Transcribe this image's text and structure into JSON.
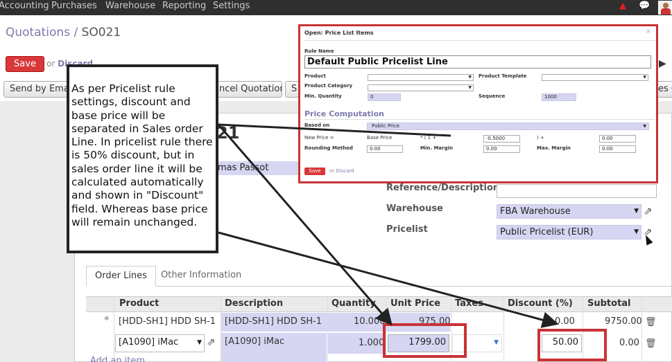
{
  "nav": {
    "menu": [
      "Accounting",
      "Purchases",
      "Warehouse",
      "Reporting",
      "Settings"
    ],
    "icons": [
      "warning-icon",
      "chat-icon",
      "avatar"
    ]
  },
  "breadcrumb": {
    "parent": "Quotations",
    "separator": " / ",
    "current": "SO021"
  },
  "toolbar": {
    "save": "Save",
    "or": "or",
    "discard": "Discard"
  },
  "actions": {
    "send_by_email": "Send by Email",
    "cancel_quotation": "Cancel Quotation",
    "btn3": "S",
    "btn4": "es C"
  },
  "form": {
    "so_number_fragment": "21",
    "customer_fragment": "mas Passot",
    "reference_label": "Reference/Description",
    "reference_value": "",
    "warehouse_label": "Warehouse",
    "warehouse_value": "FBA Warehouse",
    "pricelist_label": "Pricelist",
    "pricelist_value": "Public Pricelist (EUR)"
  },
  "tabs": [
    "Order Lines",
    "Other Information"
  ],
  "table": {
    "headers": [
      "Product",
      "Description",
      "Quantity",
      "Unit Price",
      "Taxes",
      "Discount (%)",
      "Subtotal"
    ],
    "rows": [
      {
        "product": "[HDD-SH1] HDD SH-1",
        "description": "[HDD-SH1] HDD SH-1",
        "quantity": "10.000",
        "unit_price": "975.00",
        "taxes": "",
        "discount": "0.00",
        "subtotal": "9750.00"
      },
      {
        "product": "[A1090] iMac",
        "description": "[A1090] iMac",
        "quantity": "1.000",
        "unit_price": "1799.00",
        "taxes": "",
        "discount": "50.00",
        "subtotal": "0.00"
      }
    ],
    "add_item": "Add an item"
  },
  "popup": {
    "title": "Open: Price List Items",
    "close": "×",
    "rule_name_label": "Rule Name",
    "rule_name_value": "Default Public Pricelist Line",
    "product_label": "Product",
    "product_template_label": "Product Template",
    "product_category_label": "Product Category",
    "min_quantity_label": "Min. Quantity",
    "min_quantity_value": "0",
    "sequence_label": "Sequence",
    "sequence_value": "1000",
    "section_title": "Price Computation",
    "based_on_label": "Based on",
    "based_on_value": "Public Price",
    "new_price_label": "New Price =",
    "base_price_label": "Base Price",
    "formula_open": "* ( 1 +",
    "discount_value": "-0.5000",
    "formula_close": ") +",
    "surcharge_value": "0.00",
    "rounding_label": "Rounding Method",
    "rounding_value": "0.00",
    "min_margin_label": "Min. Margin",
    "min_margin_value": "0.00",
    "max_margin_label": "Max. Margin",
    "max_margin_value": "0.00",
    "save": "Save",
    "or": "or",
    "discard": "Discard"
  },
  "annotation": {
    "text": "As per Pricelist rule settings, discount and base price will be separated in Sales order Line. In pricelist rule there is 50% discount, but in sales order line it will be calculated automatically and shown in \"Discount\" field. Whereas base price will remain unchanged."
  },
  "colors": {
    "topbar": "#2f2f2f",
    "brand_purple": "#7c7bad",
    "save_red": "#d9383a",
    "highlight_red": "#c93237",
    "lavender": "#d6d6f2"
  }
}
